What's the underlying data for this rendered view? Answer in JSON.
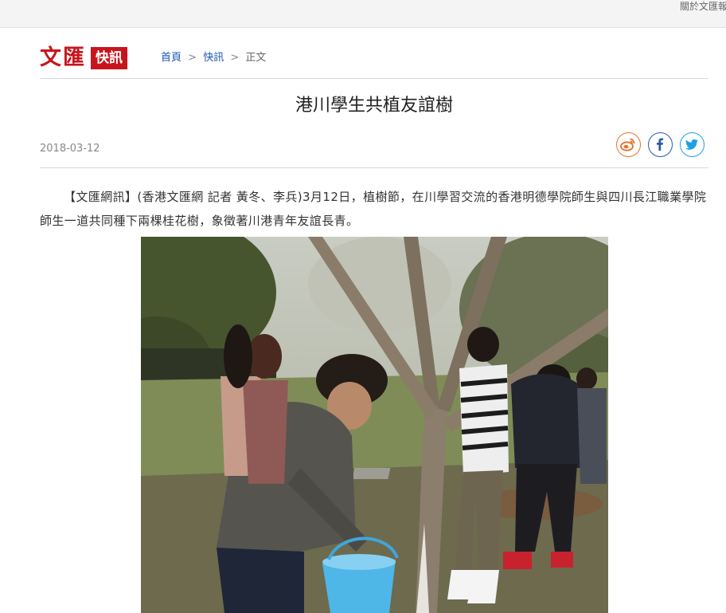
{
  "topbar": {
    "link": "關於文匯報"
  },
  "logo": {
    "main": "文匯",
    "box": "快訊"
  },
  "breadcrumb": {
    "home": "首頁",
    "section": "快訊",
    "current": "正文",
    "sep": ">"
  },
  "article": {
    "title": "港川學生共植友誼樹",
    "date": "2018-03-12",
    "body": "【文匯網訊】(香港文匯網 記者 黃冬、李兵)3月12日，植樹節，在川學習交流的香港明德學院師生與四川長江職業學院師生一道共同種下兩棵桂花樹，象徵著川港青年友誼長青。"
  },
  "share": [
    {
      "name": "weibo-icon",
      "color": "#e6722b"
    },
    {
      "name": "facebook-icon",
      "color": "#2c5aa8"
    },
    {
      "name": "twitter-icon",
      "color": "#1ea0e6"
    }
  ]
}
